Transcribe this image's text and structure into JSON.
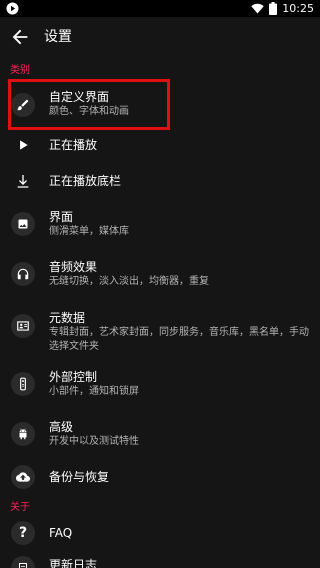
{
  "status_bar": {
    "time": "10:25",
    "icons": [
      "play-badge-icon",
      "wifi-icon",
      "battery-icon"
    ]
  },
  "app_bar": {
    "title": "设置",
    "back_icon": "back-arrow-icon"
  },
  "sections": [
    {
      "header": "类别"
    },
    {
      "header": "关于"
    }
  ],
  "items": [
    {
      "label": "自定义界面",
      "summary": "颜色、字体和动画",
      "icon": "brush-icon",
      "highlighted": true
    },
    {
      "label": "正在播放",
      "summary": "",
      "icon": "play-icon"
    },
    {
      "label": "正在播放底栏",
      "summary": "",
      "icon": "download-bar-icon"
    },
    {
      "label": "界面",
      "summary": "侧滑菜单，媒体库",
      "icon": "image-icon"
    },
    {
      "label": "音频效果",
      "summary": "无缝切换，淡入淡出，均衡器，重复",
      "icon": "headphones-icon"
    },
    {
      "label": "元数据",
      "summary": "专辑封面，艺术家封面，同步服务，音乐库，黑名单，手动选择文件夹",
      "icon": "metadata-icon"
    },
    {
      "label": "外部控制",
      "summary": "小部件，通知和锁屏",
      "icon": "remote-icon"
    },
    {
      "label": "高级",
      "summary": "开发中以及测试特性",
      "icon": "android-icon"
    },
    {
      "label": "备份与恢复",
      "summary": "",
      "icon": "cloud-upload-icon"
    },
    {
      "label": "FAQ",
      "summary": "",
      "icon": "help-icon"
    },
    {
      "label": "更新日志",
      "summary": "",
      "icon": "changelog-icon"
    }
  ],
  "colors": {
    "background": "#151515",
    "accent": "#ff1f5a",
    "highlight_box": "#e01010",
    "summary_text": "#b3b3b3"
  }
}
